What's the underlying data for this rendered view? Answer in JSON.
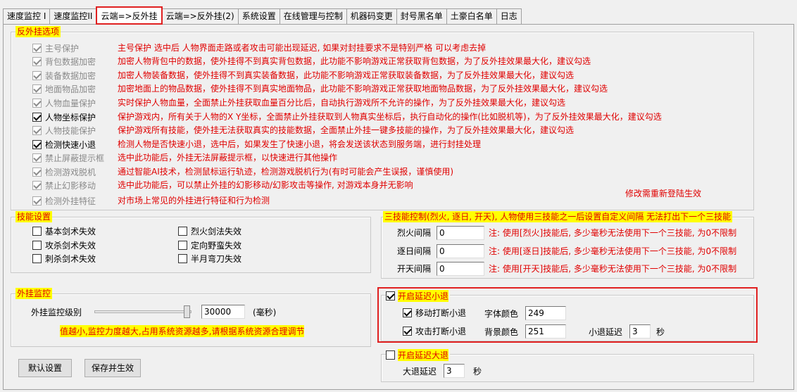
{
  "tabs": [
    {
      "label": "速度监控 I"
    },
    {
      "label": "速度监控II"
    },
    {
      "label": "云端=>反外挂"
    },
    {
      "label": "云端=>反外挂(2)"
    },
    {
      "label": "系统设置"
    },
    {
      "label": "在线管理与控制"
    },
    {
      "label": "机器码变更"
    },
    {
      "label": "封号黑名单"
    },
    {
      "label": "土豪白名单"
    },
    {
      "label": "日志"
    }
  ],
  "anticheat": {
    "title": "反外挂选项",
    "items": [
      {
        "label": "主号保护",
        "checked": true,
        "enabled": false,
        "desc": "主号保护  选中后 人物界面走路或者攻击可能出现延迟, 如果对封挂要求不是特别严格 可以考虑去掉"
      },
      {
        "label": "背包数据加密",
        "checked": true,
        "enabled": false,
        "desc": "加密人物背包中的数据，使外挂得不到真实背包数据，此功能不影响游戏正常获取背包数据，为了反外挂效果最大化，建议勾选"
      },
      {
        "label": "装备数据加密",
        "checked": true,
        "enabled": false,
        "desc": "加密人物装备数据，使外挂得不到真实装备数据，此功能不影响游戏正常获取装备数据，为了反外挂效果最大化，建议勾选"
      },
      {
        "label": "地面物品加密",
        "checked": true,
        "enabled": false,
        "desc": "加密地面上的物品数据，使外挂得不到真实地面物品，此功能不影响游戏正常获取地面物品数据，为了反外挂效果最大化，建议勾选"
      },
      {
        "label": "人物血量保护",
        "checked": true,
        "enabled": false,
        "desc": "实时保护人物血量，全面禁止外挂获取血量百分比后，自动执行游戏所不允许的操作，为了反外挂效果最大化，建议勾选"
      },
      {
        "label": "人物坐标保护",
        "checked": true,
        "enabled": true,
        "desc": "保护游戏内，所有关于人物的X Y坐标，全面禁止外挂获取到人物真实坐标后，执行自动化的操作(比如脱机等)，为了反外挂效果最大化，建议勾选"
      },
      {
        "label": "人物技能保护",
        "checked": true,
        "enabled": false,
        "desc": "保护游戏所有技能，使外挂无法获取真实的技能数据，全面禁止外挂一键多技能的操作，为了反外挂效果最大化，建议勾选"
      },
      {
        "label": "检测快速小退",
        "checked": true,
        "enabled": true,
        "desc": "检测人物是否快速小退，选中后，如果发生了快速小退，将会发送该状态到服务端，进行封挂处理"
      },
      {
        "label": "禁止屏蔽提示框",
        "checked": true,
        "enabled": false,
        "desc": "选中此功能后，外挂无法屏蔽提示框，以快速进行其他操作"
      },
      {
        "label": "检测游戏脱机",
        "checked": true,
        "enabled": false,
        "desc": "通过智能AI技术，检测鼠标运行轨迹，检测游戏脱机行为(有时可能会产生误报，谨慎使用)"
      },
      {
        "label": "禁止幻影移动",
        "checked": true,
        "enabled": false,
        "desc": "选中此功能后，可以禁止外挂的幻影移动/幻影攻击等操作, 对游戏本身并无影响"
      },
      {
        "label": "检测外挂特征",
        "checked": true,
        "enabled": false,
        "desc": "对市场上常见的外挂进行特征和行为检测"
      }
    ],
    "relogin_note": "修改需重新登陆生效"
  },
  "skill": {
    "title": "技能设置",
    "items": [
      {
        "label": "基本剑术失效",
        "checked": false
      },
      {
        "label": "攻杀剑术失效",
        "checked": false
      },
      {
        "label": "刺杀剑术失效",
        "checked": false
      },
      {
        "label": "烈火剑法失效",
        "checked": false
      },
      {
        "label": "定向野蛮失效",
        "checked": false
      },
      {
        "label": "半月弯刀失效",
        "checked": false
      }
    ]
  },
  "triple": {
    "title": "三技能控制(烈火, 逐日, 开天), 人物使用三技能之一后设置自定义间隔  无法打出下一个三技能",
    "rows": [
      {
        "label": "烈火间隔",
        "value": "0",
        "note": "注: 使用[烈火]技能后, 多少毫秒无法使用下一个三技能, 为0不限制"
      },
      {
        "label": "逐日间隔",
        "value": "0",
        "note": "注: 使用[逐日]技能后, 多少毫秒无法使用下一个三技能, 为0不限制"
      },
      {
        "label": "开天间隔",
        "value": "0",
        "note": "注: 使用[开天]技能后, 多少毫秒无法使用下一个三技能, 为0不限制"
      }
    ]
  },
  "monitor": {
    "title": "外挂监控",
    "level_label": "外挂监控级别",
    "level_value": "30000",
    "unit": "(毫秒)",
    "slider_fraction": 0.95,
    "tip": "值越小,监控力度越大,占用系统资源越多,请根据系统资源合理调节"
  },
  "small_logout": {
    "title": "开启延迟小退",
    "checked": true,
    "move_label": "移动打断小退",
    "move_checked": true,
    "attack_label": "攻击打断小退",
    "attack_checked": true,
    "font_color_label": "字体颜色",
    "font_color_value": "249",
    "bg_color_label": "背景颜色",
    "bg_color_value": "251",
    "delay_label": "小退延迟",
    "delay_value": "3",
    "delay_unit": "秒"
  },
  "big_logout": {
    "title": "开启延迟大退",
    "checked": false,
    "delay_label": "大退延迟",
    "delay_value": "3",
    "delay_unit": "秒"
  },
  "buttons": {
    "default_label": "默认设置",
    "save_label": "保存并生效"
  },
  "colors": {
    "accent_red": "#e00000",
    "highlight_yellow": "#ffff00",
    "annotation_box": "#e02020"
  }
}
